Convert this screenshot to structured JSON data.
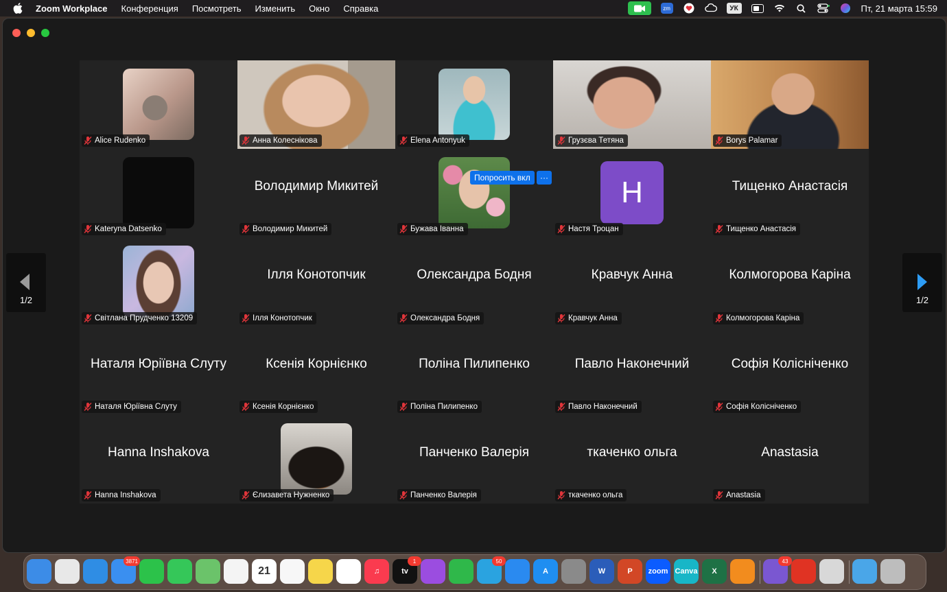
{
  "menubar": {
    "app_name": "Zoom Workplace",
    "menus": [
      "Конференция",
      "Посмотреть",
      "Изменить",
      "Окно",
      "Справка"
    ],
    "keyboard_layout": "УК",
    "clock": "Пт, 21 марта  15:59"
  },
  "meeting": {
    "speaker_color": "#3fc84e",
    "participants": [
      {
        "name": "Alice Rudenko",
        "display": "photo"
      },
      {
        "name": "Анна Колеснікова",
        "display": "video"
      },
      {
        "name": "Elena Antonyuk",
        "display": "photo"
      },
      {
        "name": "Грузєва Тетяна",
        "display": "video",
        "active_speaker": true
      },
      {
        "name": "Borys Palamar",
        "display": "video"
      },
      {
        "name": "Kateryna Datsenko",
        "display": "photo"
      },
      {
        "name": "Володимир Микитей",
        "display": "name",
        "big_name": "Володимир Микитей"
      },
      {
        "name": "Бужава Іванна",
        "display": "photo"
      },
      {
        "name": "Настя Троцан",
        "display": "avatar",
        "initial": "Н"
      },
      {
        "name": "Тищенко Анастасія",
        "display": "name",
        "big_name": "Тищенко Анастасія"
      },
      {
        "name": "Світлана Прудченко 13209",
        "display": "photo"
      },
      {
        "name": "Ілля Конотопчик",
        "display": "name",
        "big_name": "Ілля Конотопчик"
      },
      {
        "name": "Олександра Бодня",
        "display": "name",
        "big_name": "Олександра Бодня"
      },
      {
        "name": "Кравчук Анна",
        "display": "name",
        "big_name": "Кравчук Анна"
      },
      {
        "name": "Колмогорова Каріна",
        "display": "name",
        "big_name": "Колмогорова Каріна"
      },
      {
        "name": "Наталя Юріївна Слуту",
        "display": "name",
        "big_name": "Наталя Юріївна Слуту"
      },
      {
        "name": "Ксенія Корнієнко",
        "display": "name",
        "big_name": "Ксенія Корнієнко"
      },
      {
        "name": "Поліна Пилипенко",
        "display": "name",
        "big_name": "Поліна Пилипенко"
      },
      {
        "name": "Павло Наконечний",
        "display": "name",
        "big_name": "Павло Наконечний"
      },
      {
        "name": "Софія Колісніченко",
        "display": "name",
        "big_name": "Софія Колісніченко"
      },
      {
        "name": "Hanna Inshakova",
        "display": "name",
        "big_name": "Hanna Inshakova"
      },
      {
        "name": "Єлизавета Нужненко",
        "display": "photo"
      },
      {
        "name": "Панченко Валерія",
        "display": "name",
        "big_name": "Панченко Валерія"
      },
      {
        "name": "ткаченко ольга",
        "display": "name",
        "big_name": "ткаченко ольга"
      },
      {
        "name": "Anastasia",
        "display": "name",
        "big_name": "Anastasia"
      }
    ],
    "ask_to_unmute_label": "Попросить вкл",
    "more_label": "···",
    "page_indicator": "1/2"
  },
  "dock": {
    "apps": [
      {
        "name": "Finder",
        "color": "#3c8ce7",
        "text": ""
      },
      {
        "name": "Launchpad",
        "color": "#e8e8e8",
        "text": ""
      },
      {
        "name": "Safari",
        "color": "#2f8de4",
        "text": ""
      },
      {
        "name": "Mail",
        "color": "#3a8ff0",
        "text": "",
        "badge": "3871"
      },
      {
        "name": "FaceTime",
        "color": "#2cc24a",
        "text": ""
      },
      {
        "name": "Messages",
        "color": "#35c759",
        "text": ""
      },
      {
        "name": "Maps",
        "color": "#6bc36a",
        "text": ""
      },
      {
        "name": "Photos",
        "color": "#f4f4f4",
        "text": ""
      },
      {
        "name": "Calendar",
        "color": "#ffffff",
        "text": "21"
      },
      {
        "name": "Reminders",
        "color": "#f7f7f7",
        "text": ""
      },
      {
        "name": "Notes",
        "color": "#f6d64a",
        "text": ""
      },
      {
        "name": "Freeform",
        "color": "#ffffff",
        "text": ""
      },
      {
        "name": "Music",
        "color": "#fa3b4f",
        "text": "♫"
      },
      {
        "name": "TV",
        "color": "#111111",
        "text": "tv",
        "badge": "1"
      },
      {
        "name": "Podcasts",
        "color": "#9b4de0",
        "text": ""
      },
      {
        "name": "Numbers",
        "color": "#2fb84a",
        "text": ""
      },
      {
        "name": "Telegram",
        "color": "#2aa3e0",
        "text": "",
        "badge": "50"
      },
      {
        "name": "Keynote",
        "color": "#2a8af0",
        "text": ""
      },
      {
        "name": "App Store",
        "color": "#1f8ef1",
        "text": "A"
      },
      {
        "name": "System Settings",
        "color": "#8a8a8a",
        "text": ""
      },
      {
        "name": "Word",
        "color": "#2b5db9",
        "text": "W"
      },
      {
        "name": "PowerPoint",
        "color": "#d24726",
        "text": "P"
      },
      {
        "name": "Zoom",
        "color": "#0b5cff",
        "text": "zoom"
      },
      {
        "name": "Canva",
        "color": "#18b6c7",
        "text": "Canva"
      },
      {
        "name": "Excel",
        "color": "#1e7145",
        "text": "X"
      },
      {
        "name": "VLC",
        "color": "#f28c1e",
        "text": ""
      },
      {
        "name": "Viber",
        "color": "#7a57d1",
        "text": "",
        "badge": "43"
      },
      {
        "name": "Acrobat",
        "color": "#e03323",
        "text": ""
      },
      {
        "name": "Preview",
        "color": "#d8d8d8",
        "text": ""
      },
      {
        "name": "Downloads",
        "color": "#4aa6e8",
        "text": ""
      },
      {
        "name": "Trash",
        "color": "#bdbdbd",
        "text": ""
      }
    ]
  }
}
